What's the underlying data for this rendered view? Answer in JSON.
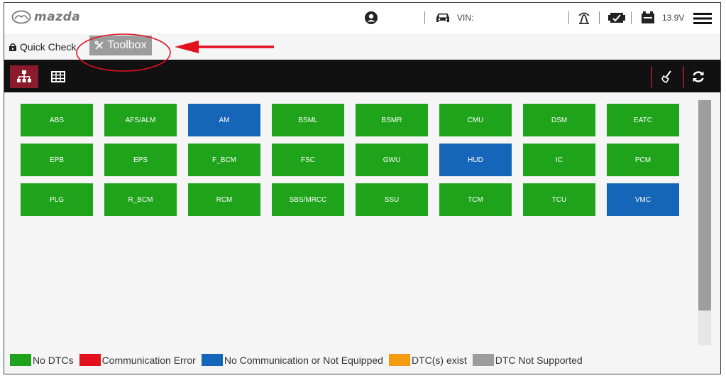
{
  "header": {
    "brand": "mazda",
    "vin_label": "VIN:",
    "voltage": "13.9V"
  },
  "tabs": [
    {
      "label": "Quick Check",
      "active": false
    },
    {
      "label": "Toolbox",
      "active": true
    }
  ],
  "toolbar": {
    "views": [
      {
        "icon": "topology-view-icon",
        "active": true
      },
      {
        "icon": "table-view-icon",
        "active": false
      }
    ],
    "actions": [
      "clear-dtc-icon",
      "refresh-icon"
    ]
  },
  "modules": [
    {
      "name": "ABS",
      "status": "no-dtc"
    },
    {
      "name": "AFS/ALM",
      "status": "no-dtc"
    },
    {
      "name": "AM",
      "status": "no-communication"
    },
    {
      "name": "BSML",
      "status": "no-dtc"
    },
    {
      "name": "BSMR",
      "status": "no-dtc"
    },
    {
      "name": "CMU",
      "status": "no-dtc"
    },
    {
      "name": "DSM",
      "status": "no-dtc"
    },
    {
      "name": "EATC",
      "status": "no-dtc"
    },
    {
      "name": "EPB",
      "status": "no-dtc"
    },
    {
      "name": "EPS",
      "status": "no-dtc"
    },
    {
      "name": "F_BCM",
      "status": "no-dtc"
    },
    {
      "name": "FSC",
      "status": "no-dtc"
    },
    {
      "name": "GWU",
      "status": "no-dtc"
    },
    {
      "name": "HUD",
      "status": "no-communication"
    },
    {
      "name": "IC",
      "status": "no-dtc"
    },
    {
      "name": "PCM",
      "status": "no-dtc"
    },
    {
      "name": "PLG",
      "status": "no-dtc"
    },
    {
      "name": "R_BCM",
      "status": "no-dtc"
    },
    {
      "name": "RCM",
      "status": "no-dtc"
    },
    {
      "name": "SBS/MRCC",
      "status": "no-dtc"
    },
    {
      "name": "SSU",
      "status": "no-dtc"
    },
    {
      "name": "TCM",
      "status": "no-dtc"
    },
    {
      "name": "TCU",
      "status": "no-dtc"
    },
    {
      "name": "VMC",
      "status": "no-communication"
    }
  ],
  "legend": [
    {
      "label": "No DTCs",
      "color": "#1fa31a"
    },
    {
      "label": "Communication Error",
      "color": "#e3101e"
    },
    {
      "label": "No Communication or Not Equipped",
      "color": "#1565b8"
    },
    {
      "label": "DTC(s) exist",
      "color": "#f39a0f"
    },
    {
      "label": "DTC Not Supported",
      "color": "#9c9c9c"
    }
  ],
  "colors": {
    "no_dtc": "#1fa31a",
    "no_communication": "#1565b8",
    "toolbar_accent": "#8b1a2b",
    "annotation": "#e3101e"
  }
}
